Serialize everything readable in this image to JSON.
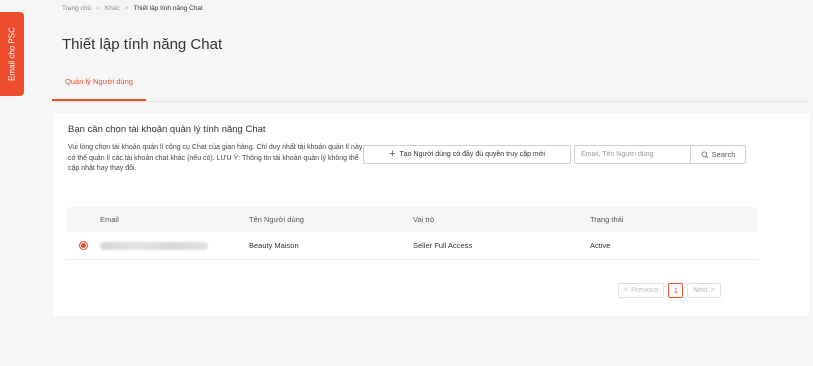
{
  "side_tab": {
    "label": "Email cho PSC"
  },
  "breadcrumb": {
    "home": "Trang chủ",
    "sep": ">",
    "other": "Khác",
    "current": "Thiết lập tính năng Chat"
  },
  "page": {
    "title": "Thiết lập tính năng Chat"
  },
  "tabs": [
    {
      "label": "Quản lý Người dùng",
      "active": true
    }
  ],
  "card": {
    "title": "Bạn cần chọn tài khoản quản lý tính năng Chat",
    "description": "Vui lòng chọn tài khoản quản lí công cụ Chat của gian hàng. Chỉ duy nhất tài khoản quản lí này có thể quản lí các tài khoản chat khác (nếu có). LƯU Ý: Thông tin tài khoản quản lý không thể cập nhật hay thay đổi.",
    "add_button": "Tạo Người dùng có đầy đủ quyền truy cập mới",
    "search_placeholder": "Email, Tên Người dùng",
    "search_button": "Search"
  },
  "table": {
    "columns": [
      "Email",
      "Tên Người dùng",
      "Vai trò",
      "Trạng thái"
    ],
    "rows": [
      {
        "selected": true,
        "name": "Beauty Maison",
        "role": "Seller Full Access",
        "status": "Active"
      }
    ]
  },
  "pagination": {
    "previous": "Previous",
    "current_page": "1",
    "next": "Next"
  },
  "colors": {
    "accent": "#ee4d2d",
    "background": "#f6f6f6"
  }
}
